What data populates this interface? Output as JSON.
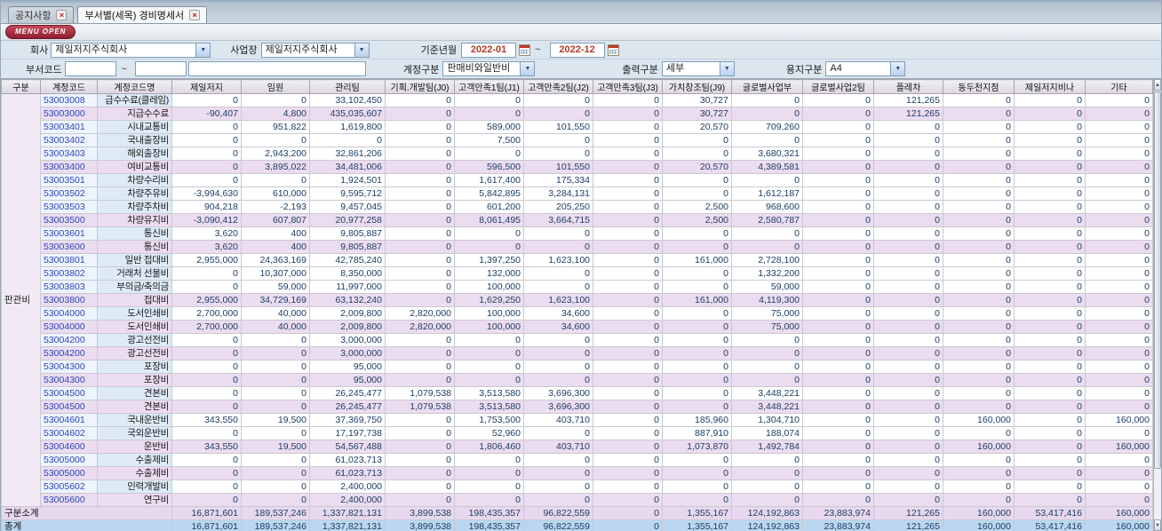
{
  "tabs": [
    {
      "label": "공지사항"
    },
    {
      "label": "부서별(세목) 경비명세서"
    }
  ],
  "menu_button": "MENU OPEN",
  "icons": {
    "close": "×",
    "combo_arrow": "▼",
    "arrow_up": "▲",
    "arrow_down": "▼"
  },
  "colors": {
    "menu_button_bg": "#8f1f30",
    "date_text": "#b03a26",
    "account_code_text": "#2b47bb",
    "detail_code_bg": "#eef4fd",
    "detail_name_bg": "#dfeaf7",
    "summary_row_bg": "#ecdcf0",
    "subtotal_row_bg": "#e7d8ee",
    "total_row_bg": "#bad6f0",
    "header_bg": "#e4dfe9"
  },
  "filters": {
    "company_label": "회사",
    "company_value": "제일저지주식회사",
    "workplace_label": "사업장",
    "workplace_value": "제일저지주식회사",
    "period_label": "기준년월",
    "period_from": "2022-01",
    "period_to": "2022-12",
    "tilde": "~",
    "dept_code_label": "부서코드",
    "dept_from": "",
    "dept_to": "",
    "dept_name": "",
    "account_type_label": "계정구분",
    "account_type_value": "판매비와일반비",
    "output_type_label": "출력구분",
    "output_type_value": "세부",
    "paper_type_label": "용지구분",
    "paper_type_value": "A4"
  },
  "table": {
    "headers": [
      "구분",
      "계정코드",
      "계정코드명",
      "제일저지",
      "임원",
      "관리팀",
      "기획.개발팀(J0)",
      "고객만족1팀(J1)",
      "고객만족2팀(J2)",
      "고객만족3팀(J3)",
      "가치창조팀(J9)",
      "글로벌사업부",
      "글로벌사업2팀",
      "플레차",
      "동두천지점",
      "제일저지비나",
      "기타"
    ],
    "group_label": "판관비",
    "group_rowspan": 31,
    "rows": [
      {
        "type": "detail",
        "code": "53003008",
        "name": "급수수료(클레임)",
        "values": [
          "0",
          "0",
          "33,102,450",
          "0",
          "0",
          "0",
          "0",
          "30,727",
          "0",
          "0",
          "121,265",
          "0",
          "0",
          "0"
        ]
      },
      {
        "type": "summary",
        "code": "53003000",
        "name": "지급수수료",
        "values": [
          "-90,407",
          "4,800",
          "435,035,607",
          "0",
          "0",
          "0",
          "0",
          "30,727",
          "0",
          "0",
          "121,265",
          "0",
          "0",
          "0"
        ]
      },
      {
        "type": "detail",
        "code": "53003401",
        "name": "시내교통비",
        "values": [
          "0",
          "951,822",
          "1,619,800",
          "0",
          "589,000",
          "101,550",
          "0",
          "20,570",
          "709,260",
          "0",
          "0",
          "0",
          "0",
          "0"
        ]
      },
      {
        "type": "detail",
        "code": "53003402",
        "name": "국내출장비",
        "values": [
          "0",
          "0",
          "0",
          "0",
          "7,500",
          "0",
          "0",
          "0",
          "0",
          "0",
          "0",
          "0",
          "0",
          "0"
        ]
      },
      {
        "type": "detail",
        "code": "53003403",
        "name": "해외출장비",
        "values": [
          "0",
          "2,943,200",
          "32,861,206",
          "0",
          "0",
          "0",
          "0",
          "0",
          "3,680,321",
          "0",
          "0",
          "0",
          "0",
          "0"
        ]
      },
      {
        "type": "summary",
        "code": "53003400",
        "name": "여비교통비",
        "values": [
          "0",
          "3,895,022",
          "34,481,006",
          "0",
          "596,500",
          "101,550",
          "0",
          "20,570",
          "4,389,581",
          "0",
          "0",
          "0",
          "0",
          "0"
        ]
      },
      {
        "type": "detail",
        "code": "53003501",
        "name": "차량수리비",
        "values": [
          "0",
          "0",
          "1,924,501",
          "0",
          "1,617,400",
          "175,334",
          "0",
          "0",
          "0",
          "0",
          "0",
          "0",
          "0",
          "0"
        ]
      },
      {
        "type": "detail",
        "code": "53003502",
        "name": "차량주유비",
        "values": [
          "-3,994,630",
          "610,000",
          "9,595,712",
          "0",
          "5,842,895",
          "3,284,131",
          "0",
          "0",
          "1,612,187",
          "0",
          "0",
          "0",
          "0",
          "0"
        ]
      },
      {
        "type": "detail",
        "code": "53003503",
        "name": "차량주차비",
        "values": [
          "904,218",
          "-2,193",
          "9,457,045",
          "0",
          "601,200",
          "205,250",
          "0",
          "2,500",
          "968,600",
          "0",
          "0",
          "0",
          "0",
          "0"
        ]
      },
      {
        "type": "summary",
        "code": "53003500",
        "name": "차량유지비",
        "values": [
          "-3,090,412",
          "607,807",
          "20,977,258",
          "0",
          "8,061,495",
          "3,664,715",
          "0",
          "2,500",
          "2,580,787",
          "0",
          "0",
          "0",
          "0",
          "0"
        ]
      },
      {
        "type": "detail",
        "code": "53003601",
        "name": "통신비",
        "values": [
          "3,620",
          "400",
          "9,805,887",
          "0",
          "0",
          "0",
          "0",
          "0",
          "0",
          "0",
          "0",
          "0",
          "0",
          "0"
        ]
      },
      {
        "type": "summary",
        "code": "53003600",
        "name": "통신비",
        "values": [
          "3,620",
          "400",
          "9,805,887",
          "0",
          "0",
          "0",
          "0",
          "0",
          "0",
          "0",
          "0",
          "0",
          "0",
          "0"
        ]
      },
      {
        "type": "detail",
        "code": "53003801",
        "name": "일반 접대비",
        "values": [
          "2,955,000",
          "24,363,169",
          "42,785,240",
          "0",
          "1,397,250",
          "1,623,100",
          "0",
          "161,000",
          "2,728,100",
          "0",
          "0",
          "0",
          "0",
          "0"
        ]
      },
      {
        "type": "detail",
        "code": "53003802",
        "name": "거래처 선물비",
        "values": [
          "0",
          "10,307,000",
          "8,350,000",
          "0",
          "132,000",
          "0",
          "0",
          "0",
          "1,332,200",
          "0",
          "0",
          "0",
          "0",
          "0"
        ]
      },
      {
        "type": "detail",
        "code": "53003803",
        "name": "부의금/축의금",
        "values": [
          "0",
          "59,000",
          "11,997,000",
          "0",
          "100,000",
          "0",
          "0",
          "0",
          "59,000",
          "0",
          "0",
          "0",
          "0",
          "0"
        ]
      },
      {
        "type": "summary",
        "code": "53003800",
        "name": "접대비",
        "values": [
          "2,955,000",
          "34,729,169",
          "63,132,240",
          "0",
          "1,629,250",
          "1,623,100",
          "0",
          "161,000",
          "4,119,300",
          "0",
          "0",
          "0",
          "0",
          "0"
        ]
      },
      {
        "type": "detail",
        "code": "53004000",
        "name": "도서인쇄비",
        "values": [
          "2,700,000",
          "40,000",
          "2,009,800",
          "2,820,000",
          "100,000",
          "34,600",
          "0",
          "0",
          "75,000",
          "0",
          "0",
          "0",
          "0",
          "0"
        ]
      },
      {
        "type": "summary",
        "code": "53004000",
        "name": "도서인쇄비",
        "values": [
          "2,700,000",
          "40,000",
          "2,009,800",
          "2,820,000",
          "100,000",
          "34,600",
          "0",
          "0",
          "75,000",
          "0",
          "0",
          "0",
          "0",
          "0"
        ]
      },
      {
        "type": "detail",
        "code": "53004200",
        "name": "광고선전비",
        "values": [
          "0",
          "0",
          "3,000,000",
          "0",
          "0",
          "0",
          "0",
          "0",
          "0",
          "0",
          "0",
          "0",
          "0",
          "0"
        ]
      },
      {
        "type": "summary",
        "code": "53004200",
        "name": "광고선전비",
        "values": [
          "0",
          "0",
          "3,000,000",
          "0",
          "0",
          "0",
          "0",
          "0",
          "0",
          "0",
          "0",
          "0",
          "0",
          "0"
        ]
      },
      {
        "type": "detail",
        "code": "53004300",
        "name": "포장비",
        "values": [
          "0",
          "0",
          "95,000",
          "0",
          "0",
          "0",
          "0",
          "0",
          "0",
          "0",
          "0",
          "0",
          "0",
          "0"
        ]
      },
      {
        "type": "summary",
        "code": "53004300",
        "name": "포장비",
        "values": [
          "0",
          "0",
          "95,000",
          "0",
          "0",
          "0",
          "0",
          "0",
          "0",
          "0",
          "0",
          "0",
          "0",
          "0"
        ]
      },
      {
        "type": "detail",
        "code": "53004500",
        "name": "견본비",
        "values": [
          "0",
          "0",
          "26,245,477",
          "1,079,538",
          "3,513,580",
          "3,696,300",
          "0",
          "0",
          "3,448,221",
          "0",
          "0",
          "0",
          "0",
          "0"
        ]
      },
      {
        "type": "summary",
        "code": "53004500",
        "name": "견본비",
        "values": [
          "0",
          "0",
          "26,245,477",
          "1,079,538",
          "3,513,580",
          "3,696,300",
          "0",
          "0",
          "3,448,221",
          "0",
          "0",
          "0",
          "0",
          "0"
        ]
      },
      {
        "type": "detail",
        "code": "53004601",
        "name": "국내운반비",
        "values": [
          "343,550",
          "19,500",
          "37,369,750",
          "0",
          "1,753,500",
          "403,710",
          "0",
          "185,960",
          "1,304,710",
          "0",
          "0",
          "160,000",
          "0",
          "160,000"
        ]
      },
      {
        "type": "detail",
        "code": "53004602",
        "name": "국외운반비",
        "values": [
          "0",
          "0",
          "17,197,738",
          "0",
          "52,960",
          "0",
          "0",
          "887,910",
          "188,074",
          "0",
          "0",
          "0",
          "0",
          "0"
        ]
      },
      {
        "type": "summary",
        "code": "53004600",
        "name": "운반비",
        "values": [
          "343,550",
          "19,500",
          "54,567,488",
          "0",
          "1,806,460",
          "403,710",
          "0",
          "1,073,870",
          "1,492,784",
          "0",
          "0",
          "160,000",
          "0",
          "160,000"
        ]
      },
      {
        "type": "detail",
        "code": "53005000",
        "name": "수출제비",
        "values": [
          "0",
          "0",
          "61,023,713",
          "0",
          "0",
          "0",
          "0",
          "0",
          "0",
          "0",
          "0",
          "0",
          "0",
          "0"
        ]
      },
      {
        "type": "summary",
        "code": "53005000",
        "name": "수출제비",
        "values": [
          "0",
          "0",
          "61,023,713",
          "0",
          "0",
          "0",
          "0",
          "0",
          "0",
          "0",
          "0",
          "0",
          "0",
          "0"
        ]
      },
      {
        "type": "detail",
        "code": "53005602",
        "name": "인력개발비",
        "values": [
          "0",
          "0",
          "2,400,000",
          "0",
          "0",
          "0",
          "0",
          "0",
          "0",
          "0",
          "0",
          "0",
          "0",
          "0"
        ]
      },
      {
        "type": "summary",
        "code": "53005600",
        "name": "연구비",
        "values": [
          "0",
          "0",
          "2,400,000",
          "0",
          "0",
          "0",
          "0",
          "0",
          "0",
          "0",
          "0",
          "0",
          "0",
          "0"
        ]
      },
      {
        "type": "subtotal",
        "label": "구분소계",
        "values": [
          "16,871,601",
          "189,537,246",
          "1,337,821,131",
          "3,899,538",
          "198,435,357",
          "96,822,559",
          "0",
          "1,355,167",
          "124,192,863",
          "23,883,974",
          "121,265",
          "160,000",
          "53,417,416",
          "160,000"
        ]
      },
      {
        "type": "total",
        "label": "총계",
        "values": [
          "16,871,601",
          "189,537,246",
          "1,337,821,131",
          "3,899,538",
          "198,435,357",
          "96,822,559",
          "0",
          "1,355,167",
          "124,192,863",
          "23,883,974",
          "121,265",
          "160,000",
          "53,417,416",
          "160,000"
        ]
      }
    ]
  }
}
